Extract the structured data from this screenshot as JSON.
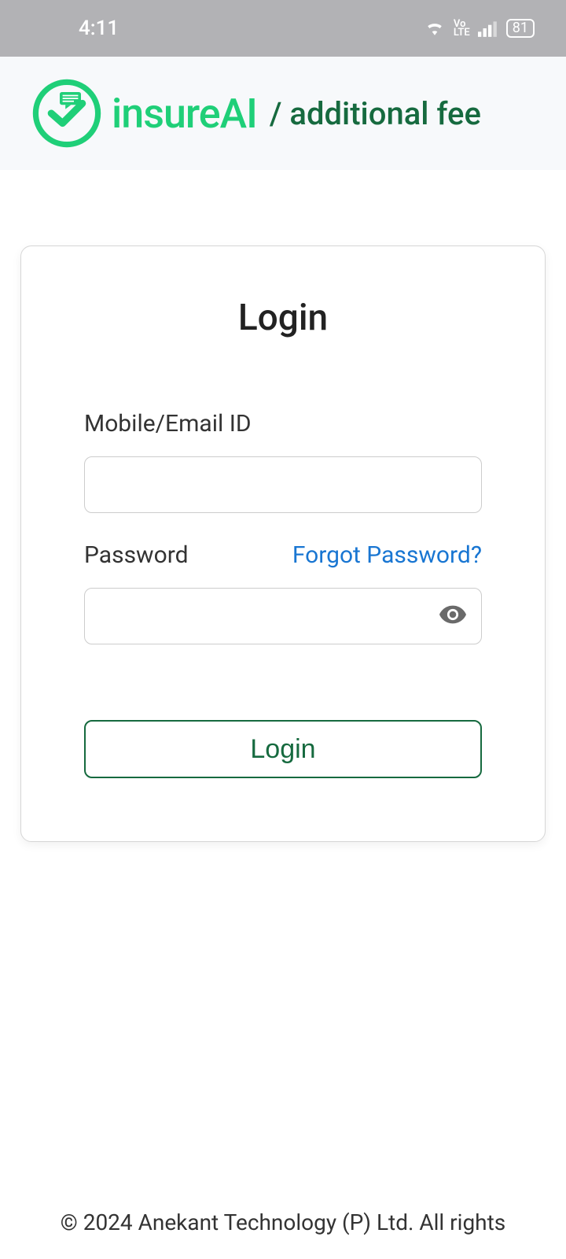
{
  "status": {
    "time": "4:11",
    "battery": "81"
  },
  "header": {
    "brand": "insureAI",
    "banner": "additional fee"
  },
  "login": {
    "title": "Login",
    "mobile_label": "Mobile/Email ID",
    "password_label": "Password",
    "forgot_label": "Forgot Password?",
    "button_label": "Login"
  },
  "footer": {
    "copyright": "© 2024 Anekant Technology (P) Ltd. All rights"
  }
}
